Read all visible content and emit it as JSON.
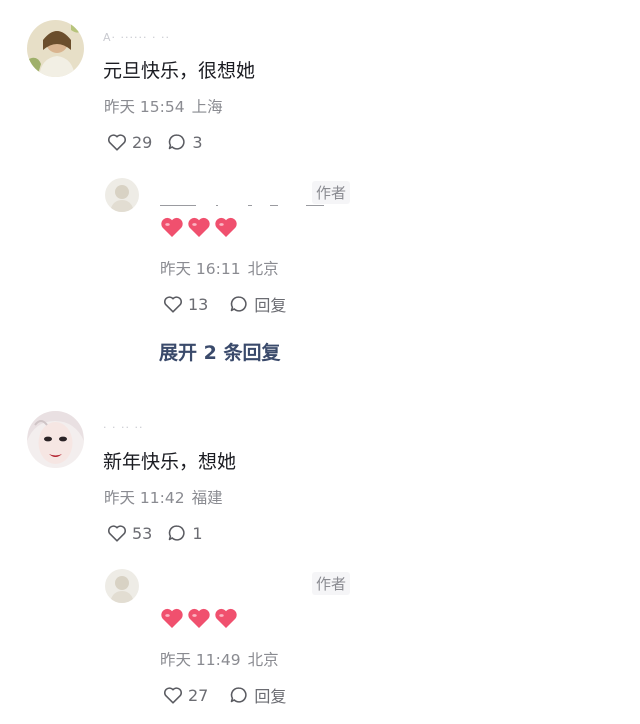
{
  "comments": [
    {
      "username": "A· ······ · ··",
      "text": "元旦快乐，很想她",
      "time": "昨天 15:54",
      "location": "上海",
      "likes": "29",
      "replies": "3",
      "reply": {
        "author_tag": "作者",
        "time": "昨天 16:11",
        "location": "北京",
        "likes": "13",
        "reply_label": "回复"
      },
      "expand_label": "展开 2 条回复"
    },
    {
      "username": "· · ·· ··",
      "text": "新年快乐，想她",
      "time": "昨天 11:42",
      "location": "福建",
      "likes": "53",
      "replies": "1",
      "reply": {
        "author_tag": "作者",
        "time": "昨天 11:49",
        "location": "北京",
        "likes": "27",
        "reply_label": "回复"
      }
    }
  ],
  "icons": {
    "like": "heart-outline-icon",
    "comment": "speech-bubble-icon",
    "emoji": "red-heart-emoji"
  },
  "colors": {
    "heart_emoji": "#f0506e",
    "expand_link": "#3a4a6b",
    "meta": "#8a8b91"
  }
}
